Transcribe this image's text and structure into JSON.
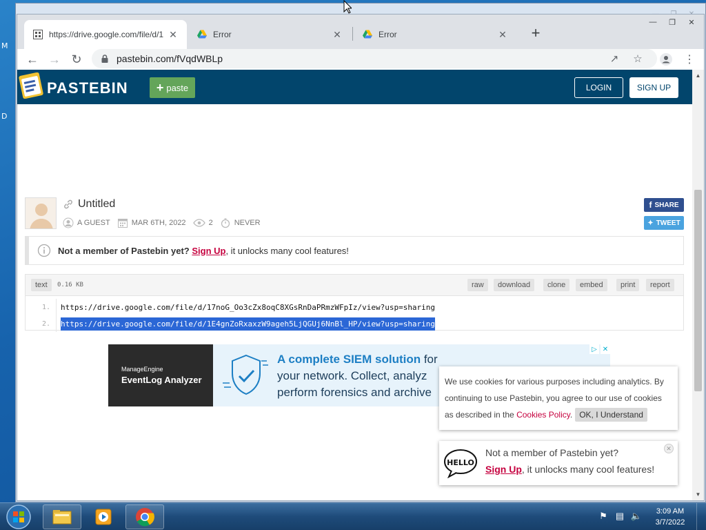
{
  "desktop": {
    "letters": [
      "M",
      "D"
    ]
  },
  "browser": {
    "tabs": [
      {
        "label": "https://drive.google.com/file/d/1",
        "active": true
      },
      {
        "label": "Error",
        "active": false
      },
      {
        "label": "Error",
        "active": false
      }
    ],
    "address": "pastebin.com/fVqdWBLp"
  },
  "pastebin": {
    "brand": "PASTEBIN",
    "paste_btn": "paste",
    "login": "LOGIN",
    "signup": "SIGN UP",
    "post": {
      "title": "Untitled",
      "author": "A GUEST",
      "date": "MAR 6TH, 2022",
      "views": "2",
      "expire": "NEVER"
    },
    "share": {
      "facebook": "SHARE",
      "twitter": "TWEET"
    },
    "notice": {
      "bold": "Not a member of Pastebin yet?",
      "link": "Sign Up",
      "rest": ", it unlocks many cool features!"
    },
    "code": {
      "syntax": "text",
      "size": "0.16 KB",
      "actions": [
        "raw",
        "download",
        "clone",
        "embed",
        "print",
        "report"
      ],
      "lines": [
        {
          "num": "1.",
          "text": "https://drive.google.com/file/d/17noG_Oo3cZx8oqC8XGsRnDaPRmzWFpIz/view?usp=sharing"
        },
        {
          "num": "2.",
          "text": "https://drive.google.com/file/d/1E4gnZoRxaxzW9ageh5LjQGUj6NnBl_HP/view?usp=sharing"
        }
      ]
    },
    "ad": {
      "brand_small": "ManageEngine",
      "brand_big": "EventLog Analyzer",
      "line1_a": "A complete SIEM solution",
      "line1_b": " for",
      "line2": "your network. Collect, analyz",
      "line3": "perform forensics and archive"
    },
    "cookie": {
      "text": "We use cookies for various purposes including analytics. By continuing to use Pastebin, you agree to our use of cookies as described in the ",
      "link": "Cookies Policy",
      "button": "OK, I Understand"
    },
    "toast": {
      "question": "Not a member of Pastebin yet?",
      "link": "Sign Up",
      "rest": ", it unlocks many cool features!"
    }
  },
  "taskbar": {
    "time": "3:09 AM",
    "date": "3/7/2022"
  }
}
